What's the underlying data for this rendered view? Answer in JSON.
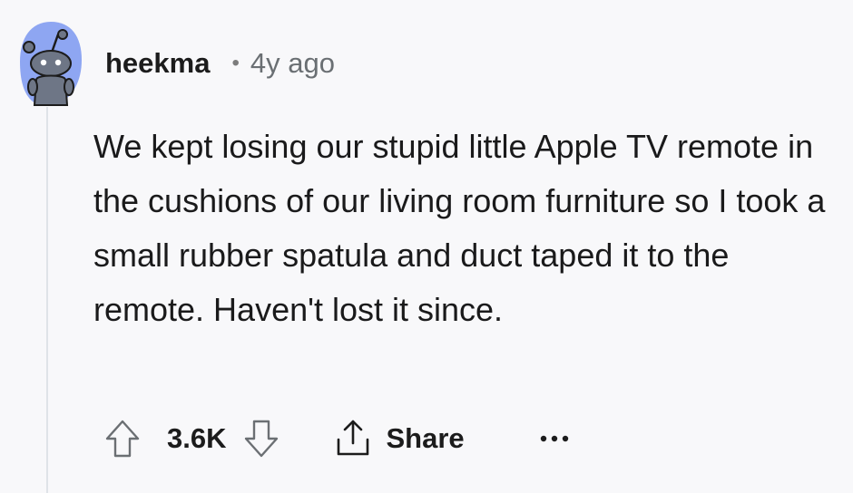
{
  "comment": {
    "author": "heekma",
    "separator": "•",
    "age": "4y ago",
    "body": "We kept losing our stupid little Apple TV remote in the cushions of our living room furniture so I took a small rubber spatula and duct taped it to the remote. Haven't lost it since.",
    "score": "3.6K",
    "share_label": "Share"
  },
  "icons": {
    "avatar": "reddit-snoo-avatar",
    "upvote": "arrow-up-outline-icon",
    "downvote": "arrow-down-outline-icon",
    "share": "share-upload-icon",
    "more": "ellipsis-icon"
  },
  "colors": {
    "background": "#f8f8fa",
    "avatar_bg": "#8ea6f2",
    "text": "#1a1a1b",
    "muted": "#6a6f73",
    "thread_line": "#dfe3e8"
  }
}
